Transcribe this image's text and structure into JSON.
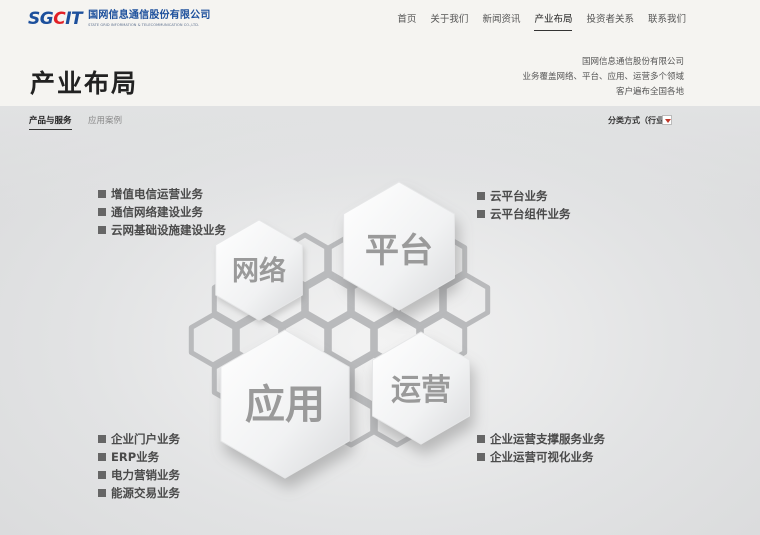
{
  "header": {
    "logo_mark": {
      "s": "S",
      "g": "G",
      "c": "C",
      "it": "IT"
    },
    "company_cn": "国网信息通信股份有限公司",
    "company_en": "STATE GRID INFORMATION & TELECOMMUNICATION CO.,LTD.",
    "nav": [
      {
        "label": "首页"
      },
      {
        "label": "关于我们"
      },
      {
        "label": "新闻资讯"
      },
      {
        "label": "产业布局",
        "active": true
      },
      {
        "label": "投资者关系"
      },
      {
        "label": "联系我们"
      }
    ]
  },
  "title_band": {
    "title": "产业布局",
    "intro_lines": [
      "国网信息通信股份有限公司",
      "业务覆盖网络、平台、应用、运营多个领域",
      "客户遍布全国各地"
    ]
  },
  "subbar": {
    "tabs": [
      {
        "label": "产品与服务",
        "active": true
      },
      {
        "label": "应用案例"
      }
    ],
    "classify_label": "分类方式（行业）"
  },
  "hexes": {
    "network": "网络",
    "platform": "平台",
    "application": "应用",
    "operation": "运营"
  },
  "lists": {
    "network": [
      "增值电信运营业务",
      "通信网络建设业务",
      "云网基础设施建设业务"
    ],
    "platform": [
      "云平台业务",
      "云平台组件业务"
    ],
    "application": [
      "企业门户业务",
      "ERP业务",
      "电力营销业务",
      "能源交易业务"
    ],
    "operation": [
      "企业运营支撑服务业务",
      "企业运营可视化业务"
    ]
  },
  "colors": {
    "brand_blue": "#1c4f9c",
    "brand_red": "#e11f26",
    "bullet": "#666666",
    "hex_label": "#9a9a9a"
  }
}
